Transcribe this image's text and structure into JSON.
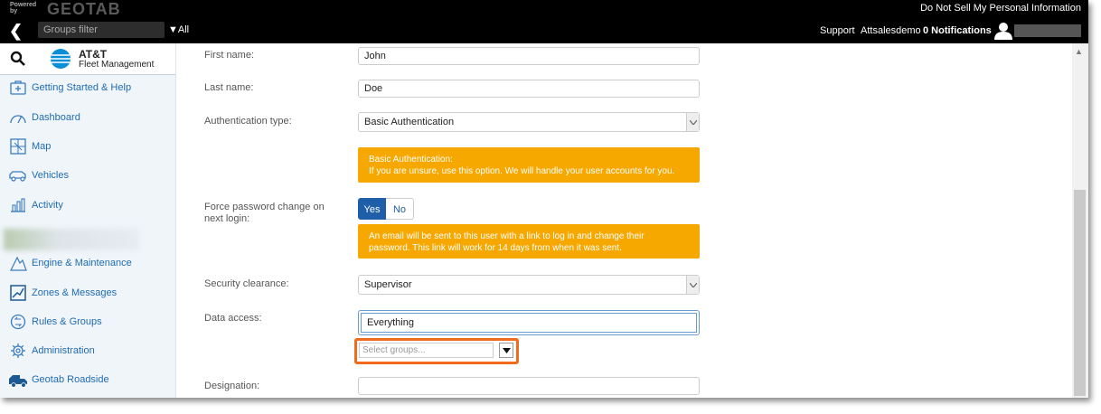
{
  "topbar": {
    "powered_by": "Powered by",
    "brand": "GEOTAB",
    "do_not_sell": "Do Not Sell My Personal Information",
    "groups_filter_placeholder": "Groups filter",
    "all_label": "All",
    "support": "Support",
    "username": "Attsalesdemo",
    "notifications": "0 Notifications"
  },
  "sidebar": {
    "logo_line1": "AT&T",
    "logo_line2": "Fleet Management",
    "items": [
      {
        "label": "Getting Started & Help",
        "icon": "help-kit-icon"
      },
      {
        "label": "Dashboard",
        "icon": "gauge-icon"
      },
      {
        "label": "Map",
        "icon": "map-icon"
      },
      {
        "label": "Vehicles",
        "icon": "vehicle-icon"
      },
      {
        "label": "Activity",
        "icon": "activity-chart-icon"
      },
      {
        "label": "Engine & Maintenance",
        "icon": "engine-icon"
      },
      {
        "label": "Zones & Messages",
        "icon": "zones-icon"
      },
      {
        "label": "Rules & Groups",
        "icon": "rules-icon"
      },
      {
        "label": "Administration",
        "icon": "gear-icon"
      },
      {
        "label": "Geotab Roadside",
        "icon": "roadside-truck-icon"
      }
    ]
  },
  "form": {
    "first_name_label": "First name:",
    "first_name_value": "John",
    "last_name_label": "Last name:",
    "last_name_value": "Doe",
    "auth_type_label": "Authentication type:",
    "auth_type_value": "Basic Authentication",
    "auth_note_title": "Basic Authentication:",
    "auth_note_body": "If you are unsure, use this option. We will handle your user accounts for you.",
    "force_pw_label_1": "Force password change on",
    "force_pw_label_2": "next login:",
    "yes": "Yes",
    "no": "No",
    "force_note_1": "An email will be sent to this user with a link to log in and change their",
    "force_note_2": "password. This link will work for 14 days from when it was sent.",
    "security_label": "Security clearance:",
    "security_value": "Supervisor",
    "data_access_label": "Data access:",
    "data_access_value": "Everything",
    "select_groups_placeholder": "Select groups...",
    "designation_label": "Designation:",
    "designation_value": ""
  },
  "colors": {
    "accent_blue": "#1f5ea8",
    "note_orange": "#f7a800",
    "highlight_orange": "#f26b1d"
  }
}
